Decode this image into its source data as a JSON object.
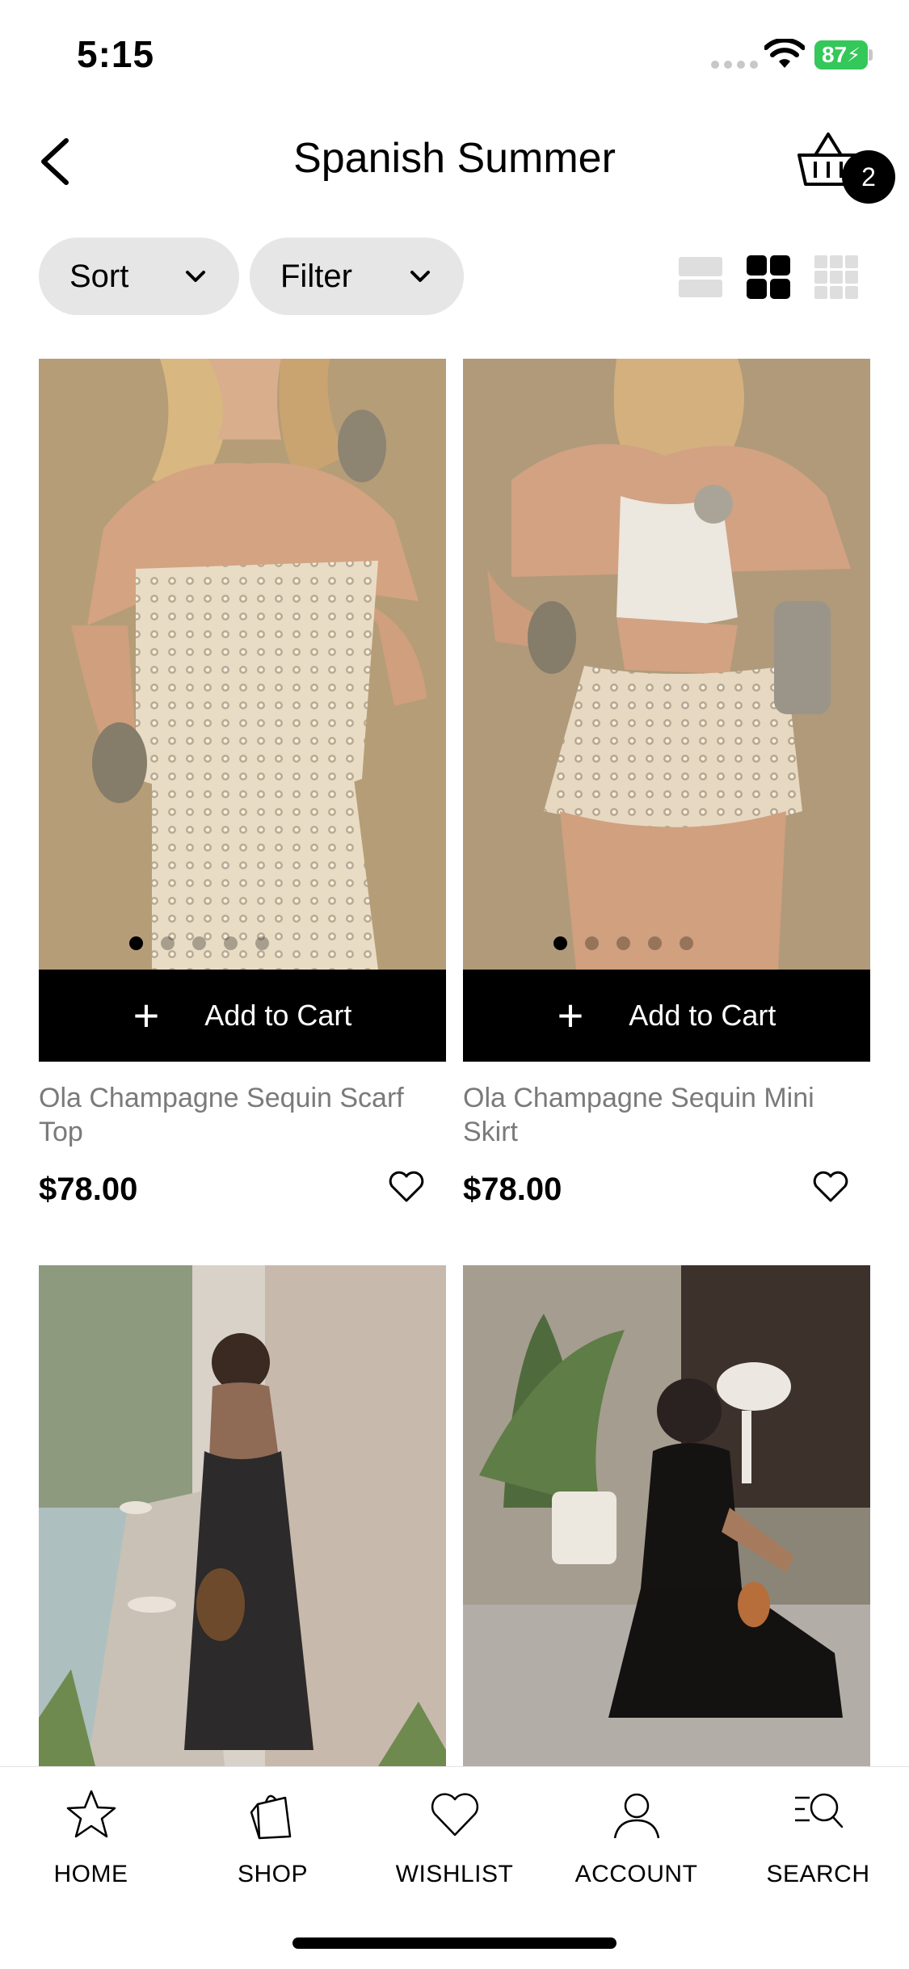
{
  "status_bar": {
    "time": "5:15",
    "battery": "87"
  },
  "header": {
    "title": "Spanish Summer",
    "cart_count": "2"
  },
  "controls": {
    "sort_label": "Sort",
    "filter_label": "Filter"
  },
  "products": [
    {
      "name": "Ola Champagne Sequin Scarf Top",
      "price": "$78.00",
      "cart_label": "Add to Cart"
    },
    {
      "name": "Ola Champagne Sequin Mini Skirt",
      "price": "$78.00",
      "cart_label": "Add to Cart"
    }
  ],
  "nav": [
    {
      "label": "HOME",
      "icon": "star-icon"
    },
    {
      "label": "SHOP",
      "icon": "bag-icon"
    },
    {
      "label": "WISHLIST",
      "icon": "heart-icon"
    },
    {
      "label": "ACCOUNT",
      "icon": "person-icon"
    },
    {
      "label": "SEARCH",
      "icon": "search-icon"
    }
  ],
  "colors": {
    "pill_bg": "#e6e6e6",
    "battery": "#34c759",
    "cart_button": "#000000",
    "product_name": "#7a7a7a"
  }
}
